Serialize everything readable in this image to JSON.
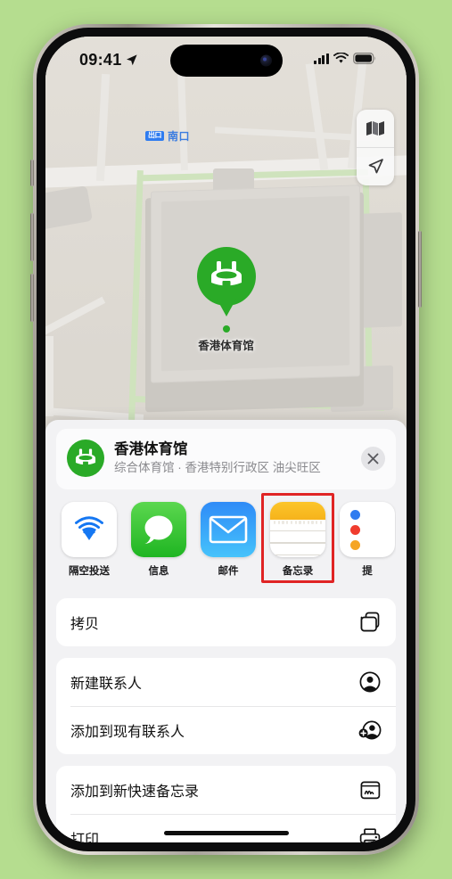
{
  "status_bar": {
    "time": "09:41",
    "location_arrow": "location-arrow-icon",
    "cellular": "signal-bars-icon",
    "wifi": "wifi-icon",
    "battery": "battery-icon"
  },
  "map": {
    "transit_label": "南口",
    "transit_badge": "出口",
    "pin_label": "香港体育馆",
    "controls": [
      {
        "name": "map-style-button",
        "icon": "folded-map-icon"
      },
      {
        "name": "locate-me-button",
        "icon": "navigation-arrow-icon"
      }
    ]
  },
  "share_sheet": {
    "venue": {
      "title": "香港体育馆",
      "subtitle": "综合体育馆 · 香港特别行政区 油尖旺区",
      "icon": "stadium-icon"
    },
    "close_label": "×",
    "apps": [
      {
        "label": "隔空投送",
        "icon": "airdrop-icon",
        "highlighted": false
      },
      {
        "label": "信息",
        "icon": "messages-icon",
        "highlighted": false
      },
      {
        "label": "邮件",
        "icon": "mail-icon",
        "highlighted": false
      },
      {
        "label": "备忘录",
        "icon": "notes-icon",
        "highlighted": true
      },
      {
        "label": "提",
        "icon": "reminders-icon",
        "highlighted": false
      }
    ],
    "groups": [
      {
        "rows": [
          {
            "label": "拷贝",
            "icon": "copy-icon"
          }
        ]
      },
      {
        "rows": [
          {
            "label": "新建联系人",
            "icon": "person-circle-icon"
          },
          {
            "label": "添加到现有联系人",
            "icon": "person-badge-plus-icon"
          }
        ]
      },
      {
        "rows": [
          {
            "label": "添加到新快速备忘录",
            "icon": "quick-note-icon"
          },
          {
            "label": "打印",
            "icon": "printer-icon"
          }
        ]
      }
    ]
  },
  "colors": {
    "background": "#b5dd8f",
    "accent_green": "#2aaa27",
    "highlight_red": "#e02424",
    "messages_green": "#34c759",
    "mail_blue": "#2f8bf7",
    "notes_yellow": "#f6b31b"
  }
}
